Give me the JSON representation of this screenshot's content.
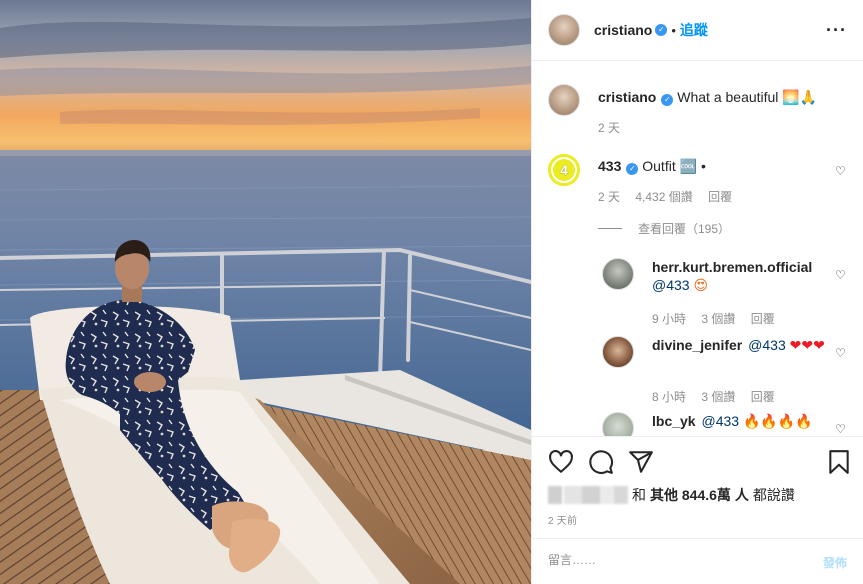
{
  "colors": {
    "accent": "#0095f6",
    "verified": "#3897f0",
    "muted": "#8e8e8e",
    "text": "#262626"
  },
  "header": {
    "username": "cristiano",
    "separator": "•",
    "follow_label": "追蹤",
    "more_icon": "more-horizontal-icon"
  },
  "caption": {
    "username": "cristiano",
    "text": "What a beautiful",
    "emoji": "🌅🙏",
    "age": "2 天"
  },
  "comments": [
    {
      "username": "433",
      "text": "Outfit",
      "emoji": "🆒",
      "trailing": "•",
      "age": "2 天",
      "likes": "4,432 個讚",
      "reply": "回覆",
      "view_replies": "查看回覆（195）"
    },
    {
      "username": "herr.kurt.bremen.official",
      "mention": "@433",
      "emoji": "😍",
      "age": "9 小時",
      "likes": "3 個讚",
      "reply": "回覆"
    },
    {
      "username": "divine_jenifer",
      "mention": "@433",
      "emoji": "❤❤❤",
      "age": "8 小時",
      "likes": "3 個讚",
      "reply": "回覆"
    },
    {
      "username": "lbc_yk",
      "mention": "@433",
      "emoji": "🔥🔥🔥🔥"
    }
  ],
  "likes_line": {
    "prefix": "和",
    "others": "其他 844.6萬 人",
    "suffix": "都說讚"
  },
  "timestamp": "2 天前",
  "add_comment": {
    "placeholder": "留言……",
    "post_label": "發佈"
  },
  "icons": [
    "heart-icon",
    "comment-icon",
    "share-icon",
    "save-icon"
  ]
}
